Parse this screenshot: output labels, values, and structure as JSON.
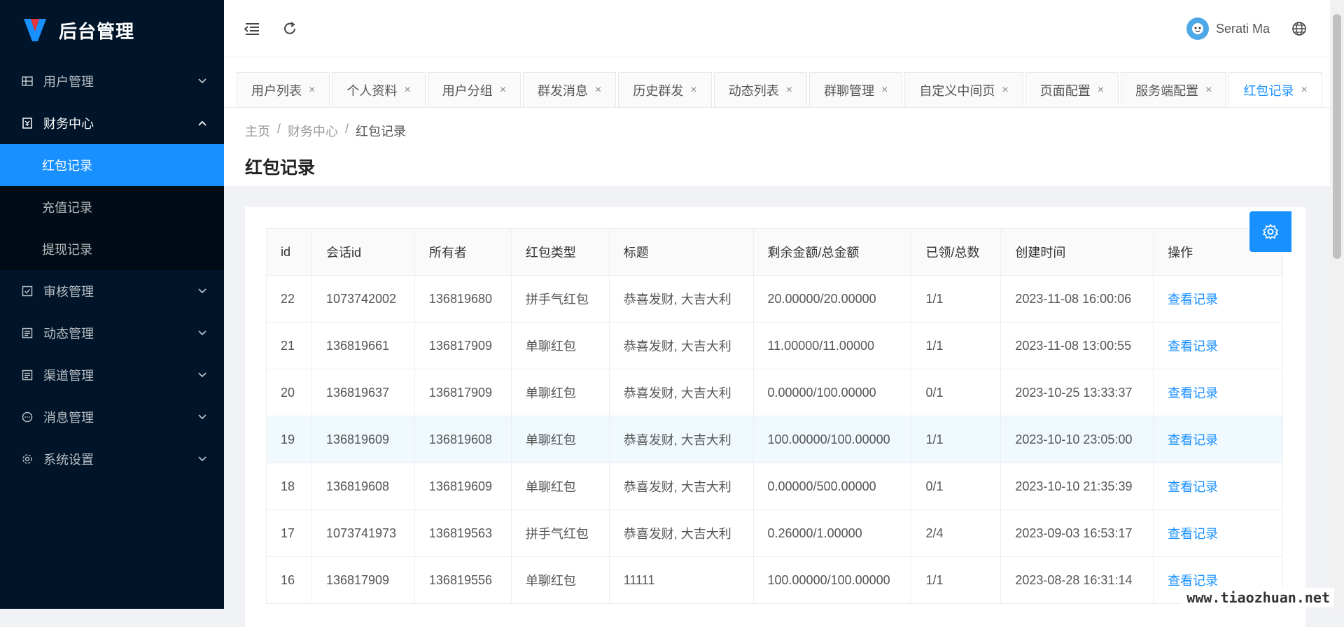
{
  "app": {
    "title": "后台管理"
  },
  "sidebar": {
    "items": [
      {
        "label": "用户管理"
      },
      {
        "label": "财务中心"
      },
      {
        "label": "审核管理"
      },
      {
        "label": "动态管理"
      },
      {
        "label": "渠道管理"
      },
      {
        "label": "消息管理"
      },
      {
        "label": "系统设置"
      }
    ],
    "finance_sub": [
      {
        "label": "红包记录"
      },
      {
        "label": "充值记录"
      },
      {
        "label": "提现记录"
      }
    ]
  },
  "header": {
    "user_name": "Serati Ma"
  },
  "tabs": [
    {
      "label": "用户列表"
    },
    {
      "label": "个人资料"
    },
    {
      "label": "用户分组"
    },
    {
      "label": "群发消息"
    },
    {
      "label": "历史群发"
    },
    {
      "label": "动态列表"
    },
    {
      "label": "群聊管理"
    },
    {
      "label": "自定义中间页"
    },
    {
      "label": "页面配置"
    },
    {
      "label": "服务端配置"
    },
    {
      "label": "红包记录"
    }
  ],
  "tab_close": "×",
  "breadcrumb": {
    "home": "主页",
    "sep": "/",
    "section": "财务中心",
    "current": "红包记录"
  },
  "page_title": "红包记录",
  "table": {
    "headers": [
      "id",
      "会话id",
      "所有者",
      "红包类型",
      "标题",
      "剩余金额/总金额",
      "已领/总数",
      "创建时间",
      "操作"
    ],
    "rows": [
      [
        "22",
        "1073742002",
        "136819680",
        "拼手气红包",
        "恭喜发财, 大吉大利",
        "20.00000/20.00000",
        "1/1",
        "2023-11-08 16:00:06",
        "查看记录"
      ],
      [
        "21",
        "136819661",
        "136817909",
        "单聊红包",
        "恭喜发财, 大吉大利",
        "11.00000/11.00000",
        "1/1",
        "2023-11-08 13:00:55",
        "查看记录"
      ],
      [
        "20",
        "136819637",
        "136817909",
        "单聊红包",
        "恭喜发财, 大吉大利",
        "0.00000/100.00000",
        "0/1",
        "2023-10-25 13:33:37",
        "查看记录"
      ],
      [
        "19",
        "136819609",
        "136819608",
        "单聊红包",
        "恭喜发财, 大吉大利",
        "100.00000/100.00000",
        "1/1",
        "2023-10-10 23:05:00",
        "查看记录"
      ],
      [
        "18",
        "136819608",
        "136819609",
        "单聊红包",
        "恭喜发财, 大吉大利",
        "0.00000/500.00000",
        "0/1",
        "2023-10-10 21:35:39",
        "查看记录"
      ],
      [
        "17",
        "1073741973",
        "136819563",
        "拼手气红包",
        "恭喜发财, 大吉大利",
        "0.26000/1.00000",
        "2/4",
        "2023-09-03 16:53:17",
        "查看记录"
      ],
      [
        "16",
        "136817909",
        "136819556",
        "单聊红包",
        "11111",
        "100.00000/100.00000",
        "1/1",
        "2023-08-28 16:31:14",
        "查看记录"
      ]
    ]
  },
  "watermark": "www.tiaozhuan.net",
  "colors": {
    "sidebar_bg": "#001529",
    "accent": "#1890ff"
  }
}
